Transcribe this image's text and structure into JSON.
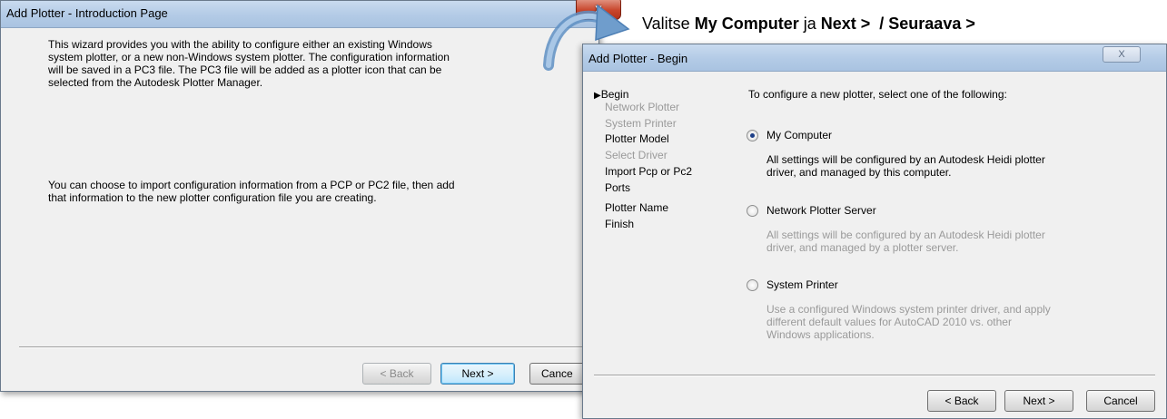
{
  "annotation": {
    "prefix": "Valitse ",
    "option": "My Computer",
    "middle": " ja ",
    "next_label": "Next >",
    "separator": "  / ",
    "next_label_fi": "Seuraava >"
  },
  "intro_dialog": {
    "title": "Add Plotter - Introduction Page",
    "paragraph1_lines": [
      "This wizard provides you with the ability to configure either an existing Windows",
      "system plotter, or a new non-Windows system plotter. The configuration information",
      "will be saved in a PC3 file. The PC3 file will be added as a plotter icon that can be",
      "selected from the Autodesk Plotter Manager."
    ],
    "paragraph2_lines": [
      "You can choose to import configuration information from a PCP or PC2 file, then add",
      "that information to the new plotter configuration file you are creating."
    ],
    "close_glyph": "x",
    "buttons": {
      "back": "< Back",
      "next": "Next >",
      "cancel": "Cance"
    }
  },
  "begin_dialog": {
    "title": "Add Plotter - Begin",
    "close_glyph": "X",
    "steps": [
      {
        "label": "Begin",
        "state": "current"
      },
      {
        "label": "Network Plotter",
        "state": "disabled"
      },
      {
        "label": "System Printer",
        "state": "disabled"
      },
      {
        "label": "Plotter Model",
        "state": "enabled"
      },
      {
        "label": "Select Driver",
        "state": "disabled"
      },
      {
        "label": "Import Pcp or Pc2",
        "state": "enabled"
      },
      {
        "label": "Ports",
        "state": "enabled"
      },
      {
        "label": "Plotter Name",
        "state": "enabled"
      },
      {
        "label": "Finish",
        "state": "enabled"
      }
    ],
    "current_step_marker": "▶",
    "instruction": "To configure a new plotter, select one of the following:",
    "options": [
      {
        "label": "My Computer",
        "selected": true,
        "desc_lines": [
          "All settings will be configured by an Autodesk Heidi plotter",
          "driver, and managed by this computer."
        ]
      },
      {
        "label": "Network Plotter Server",
        "selected": false,
        "desc_lines": [
          "All settings will be configured by an Autodesk Heidi plotter",
          "driver, and managed by a plotter server."
        ]
      },
      {
        "label": "System Printer",
        "selected": false,
        "desc_lines": [
          "Use a configured Windows system printer driver, and apply",
          "different default values for AutoCAD 2010 vs. other",
          "Windows applications."
        ]
      }
    ],
    "buttons": {
      "back": "< Back",
      "next": "Next >",
      "cancel": "Cancel"
    }
  },
  "colors": {
    "titlebar": "#b3cbe6",
    "dialog_bg": "#f0f0f0",
    "close_red": "#c8452b",
    "arrow_blue": "#7ba4cf",
    "disabled_text": "#9a9a9a"
  }
}
